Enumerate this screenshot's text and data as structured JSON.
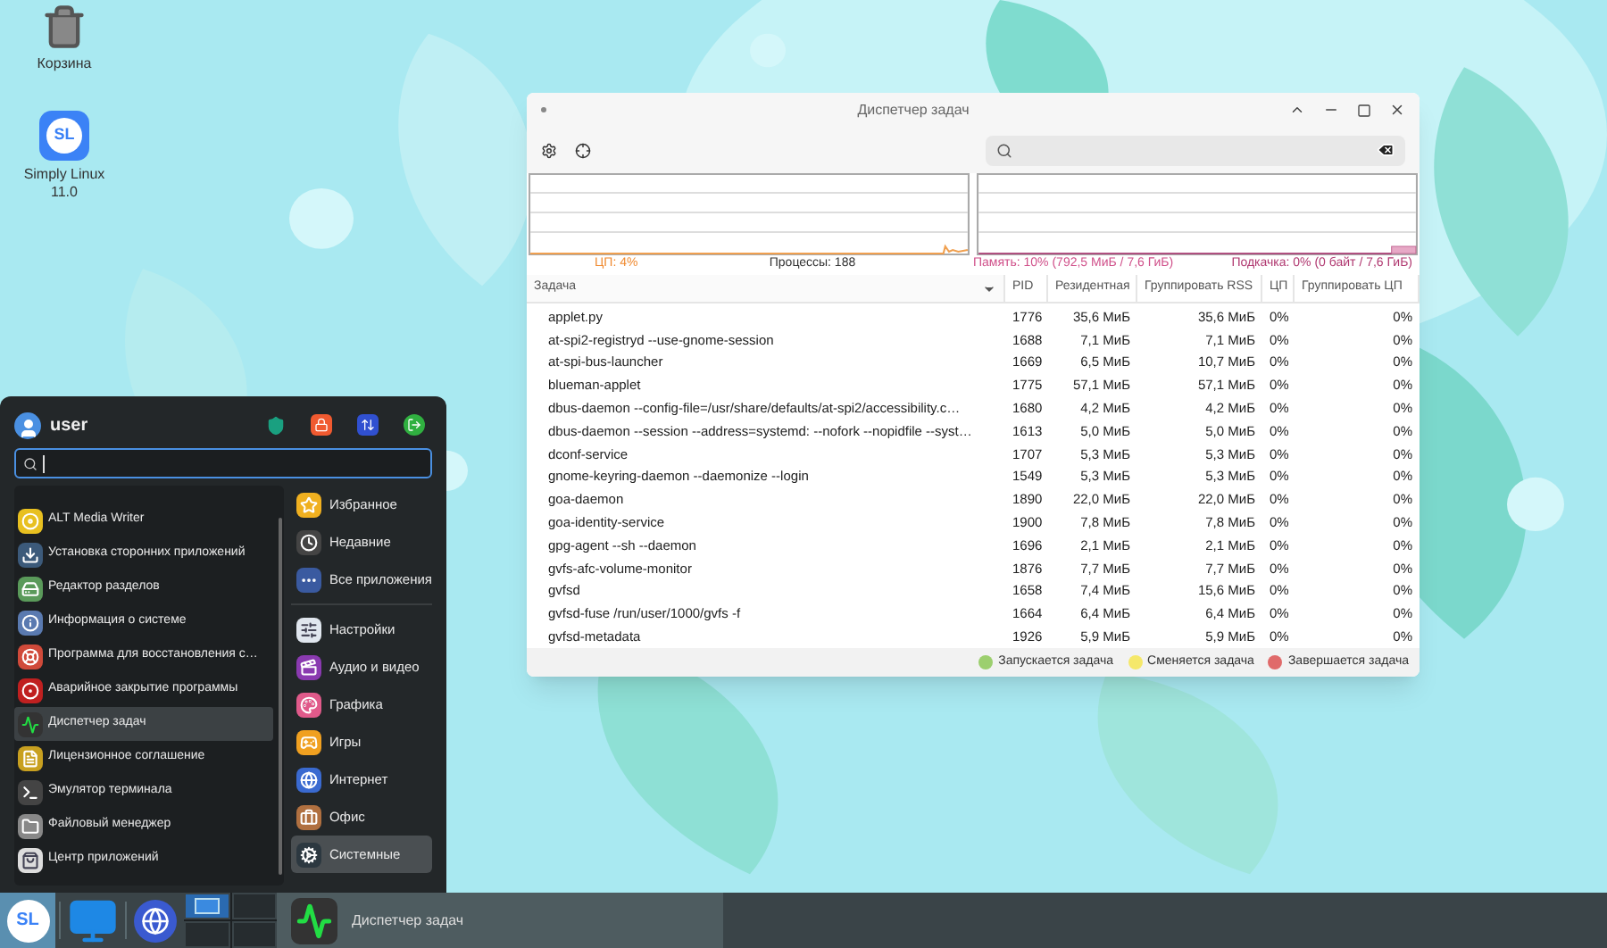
{
  "desktop_icons": [
    {
      "kind": "trash",
      "label": "Корзина"
    },
    {
      "kind": "distro",
      "label": "Simply Linux 11.0",
      "logo_text": "SL"
    }
  ],
  "window": {
    "title": "Диспетчер задач",
    "stats": {
      "cpu": "ЦП: 4%",
      "processes": "Процессы: 188",
      "memory": "Память: 10% (792,5 МиБ / 7,6 ГиБ)",
      "swap": "Подкачка: 0% (0 байт / 7,6 ГиБ)"
    },
    "columns": [
      {
        "label": "Задача",
        "sorted": true
      },
      {
        "label": "PID",
        "sorted": false
      },
      {
        "label": "Резидентная",
        "sorted": false
      },
      {
        "label": "Группировать RSS",
        "sorted": false
      },
      {
        "label": "ЦП",
        "sorted": false
      },
      {
        "label": "Группировать ЦП",
        "sorted": false
      }
    ],
    "rows": [
      [
        "applet.py",
        "1776",
        "35,6 МиБ",
        "35,6 МиБ",
        "0%",
        "0%"
      ],
      [
        "at-spi2-registryd --use-gnome-session",
        "1688",
        "7,1 МиБ",
        "7,1 МиБ",
        "0%",
        "0%"
      ],
      [
        "at-spi-bus-launcher",
        "1669",
        "6,5 МиБ",
        "10,7 МиБ",
        "0%",
        "0%"
      ],
      [
        "blueman-applet",
        "1775",
        "57,1 МиБ",
        "57,1 МиБ",
        "0%",
        "0%"
      ],
      [
        "dbus-daemon --config-file=/usr/share/defaults/at-spi2/accessibility.c…",
        "1680",
        "4,2 МиБ",
        "4,2 МиБ",
        "0%",
        "0%"
      ],
      [
        "dbus-daemon --session --address=systemd: --nofork --nopidfile --syst…",
        "1613",
        "5,0 МиБ",
        "5,0 МиБ",
        "0%",
        "0%"
      ],
      [
        "dconf-service",
        "1707",
        "5,3 МиБ",
        "5,3 МиБ",
        "0%",
        "0%"
      ],
      [
        "gnome-keyring-daemon --daemonize --login",
        "1549",
        "5,3 МиБ",
        "5,3 МиБ",
        "0%",
        "0%"
      ],
      [
        "goa-daemon",
        "1890",
        "22,0 МиБ",
        "22,0 МиБ",
        "0%",
        "0%"
      ],
      [
        "goa-identity-service",
        "1900",
        "7,8 МиБ",
        "7,8 МиБ",
        "0%",
        "0%"
      ],
      [
        "gpg-agent --sh --daemon",
        "1696",
        "2,1 МиБ",
        "2,1 МиБ",
        "0%",
        "0%"
      ],
      [
        "gvfs-afc-volume-monitor",
        "1876",
        "7,7 МиБ",
        "7,7 МиБ",
        "0%",
        "0%"
      ],
      [
        "gvfsd",
        "1658",
        "7,4 МиБ",
        "15,6 МиБ",
        "0%",
        "0%"
      ],
      [
        "gvfsd-fuse /run/user/1000/gvfs -f",
        "1664",
        "6,4 МиБ",
        "6,4 МиБ",
        "0%",
        "0%"
      ],
      [
        "gvfsd-metadata",
        "1926",
        "5,9 МиБ",
        "5,9 МиБ",
        "0%",
        "0%"
      ]
    ],
    "legend": [
      {
        "label": "Запускается задача",
        "color": "#9ccf6e"
      },
      {
        "label": "Сменяется задача",
        "color": "#f5e86a"
      },
      {
        "label": "Завершается задача",
        "color": "#e06a6a"
      }
    ]
  },
  "start_menu": {
    "user": "user",
    "apps": [
      {
        "label": "ALT Media Writer",
        "kind": "writer",
        "selected": false
      },
      {
        "label": "Установка сторонних приложений",
        "kind": "install",
        "selected": false
      },
      {
        "label": "Редактор разделов",
        "kind": "disk",
        "selected": false
      },
      {
        "label": "Информация о системе",
        "kind": "info",
        "selected": false
      },
      {
        "label": "Программа для восстановления с…",
        "kind": "restore",
        "selected": false
      },
      {
        "label": "Аварийное закрытие программы",
        "kind": "kill",
        "selected": false
      },
      {
        "label": "Диспетчер задач",
        "kind": "monitor",
        "selected": true
      },
      {
        "label": "Лицензионное соглашение",
        "kind": "license",
        "selected": false
      },
      {
        "label": "Эмулятор терминала",
        "kind": "terminal",
        "selected": false
      },
      {
        "label": "Файловый менеджер",
        "kind": "files",
        "selected": false
      },
      {
        "label": "Центр приложений",
        "kind": "store",
        "selected": false
      }
    ],
    "places": [
      {
        "label": "Избранное",
        "kind": "star",
        "selected": false
      },
      {
        "label": "Недавние",
        "kind": "clock",
        "selected": false
      },
      {
        "label": "Все приложения",
        "kind": "dots",
        "selected": false
      }
    ],
    "categories": [
      {
        "label": "Настройки",
        "kind": "settings",
        "selected": false
      },
      {
        "label": "Аудио и видео",
        "kind": "media",
        "selected": false
      },
      {
        "label": "Графика",
        "kind": "graphics",
        "selected": false
      },
      {
        "label": "Игры",
        "kind": "games",
        "selected": false
      },
      {
        "label": "Интернет",
        "kind": "internet",
        "selected": false
      },
      {
        "label": "Офис",
        "kind": "office",
        "selected": false
      },
      {
        "label": "Системные",
        "kind": "system",
        "selected": true
      }
    ]
  },
  "taskbar": {
    "logo_text": "SL",
    "workspaces": [
      {
        "selected": true
      },
      {
        "selected": false
      },
      {
        "selected": false
      },
      {
        "selected": false
      }
    ],
    "tasks": [
      {
        "label": "Диспетчер задач",
        "selected": true
      }
    ]
  }
}
